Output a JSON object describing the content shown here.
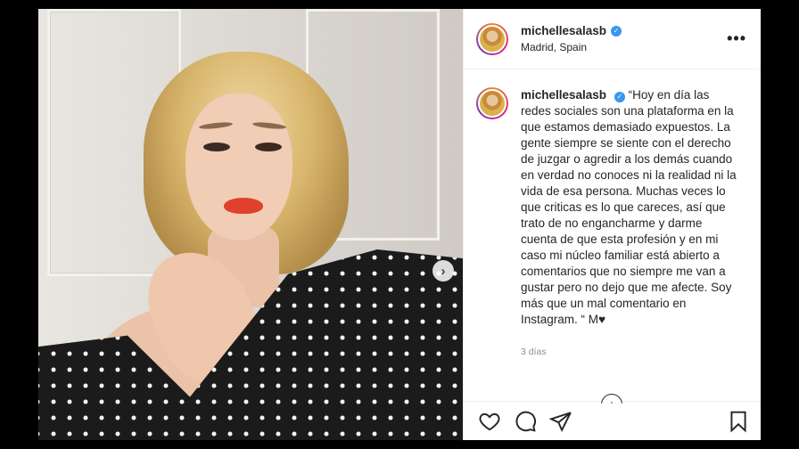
{
  "post": {
    "header": {
      "username": "michellesalasb",
      "location": "Madrid, Spain",
      "more_label": "•••"
    },
    "caption": {
      "username": "michellesalasb",
      "text": "“Hoy en día las redes sociales son una plataforma en la que estamos demasiado expuestos. La gente siempre se siente con el derecho de juzgar o agredir a los demás cuando en verdad no conoces ni la realidad ni la vida de esa persona. Muchas veces lo que criticas es lo que careces, así que trato de no engancharme y darme cuenta de que esta profesión y en mi caso mi núcleo familiar está abierto a comentarios que no siempre me van a gustar pero no dejo que me afecte. Soy más que un mal comentario en Instagram. “ M♥",
      "timestamp": "3 días"
    },
    "photo": {
      "next_icon": "chevron-right-icon",
      "next_glyph": "›"
    },
    "load_more_glyph": "+",
    "actions": [
      "heart-icon",
      "comment-icon",
      "share-icon",
      "bookmark-icon"
    ],
    "colors": {
      "verified": "#3897f0",
      "text": "#262626",
      "muted": "#8e8e8e",
      "lips": "#e0402e"
    }
  }
}
